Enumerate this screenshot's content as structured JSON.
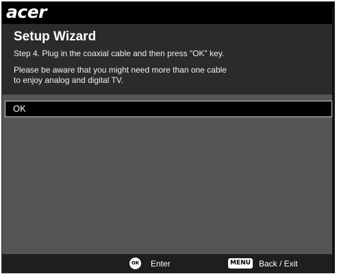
{
  "brand": {
    "logo_text": "acer"
  },
  "wizard": {
    "title": "Setup Wizard",
    "step_text": "Step 4. Plug in the coaxial cable and then press \"OK\" key.",
    "note_line1": "Please be aware that you might need more than one cable",
    "note_line2": "to enjoy analog and digital TV."
  },
  "options": {
    "items": [
      {
        "label": "OK",
        "selected": true
      }
    ]
  },
  "footer": {
    "ok_icon_text": "OK",
    "ok_action": "Enter",
    "menu_icon_text": "MENU",
    "menu_action": "Back / Exit"
  },
  "colors": {
    "background": "#555555",
    "header_background": "#2b2b2b",
    "top_bar": "#000000",
    "selected_item": "#000000",
    "text": "#ffffff"
  }
}
